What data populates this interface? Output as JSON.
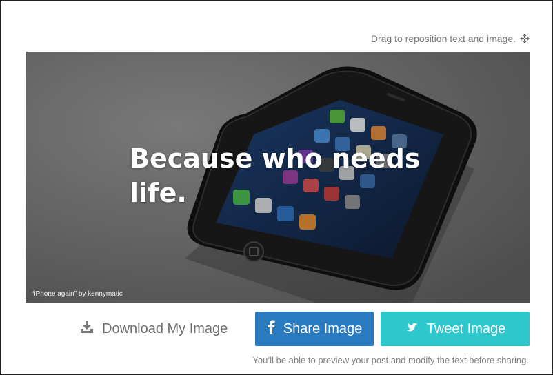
{
  "hint": {
    "text": "Drag to reposition text and image.",
    "icon": "move-arrows-icon"
  },
  "canvas": {
    "quote": "Because who needs life.",
    "credit": "“iPhone again” by kennymatic"
  },
  "actions": {
    "download_label": "Download My Image",
    "download_icon": "download-icon",
    "share_label": "Share Image",
    "share_icon": "facebook-icon",
    "share_color": "#2b7bc0",
    "tweet_label": "Tweet Image",
    "tweet_icon": "twitter-icon",
    "tweet_color": "#2ec7cb"
  },
  "note": "You’ll be able to preview your post and modify the text before sharing."
}
